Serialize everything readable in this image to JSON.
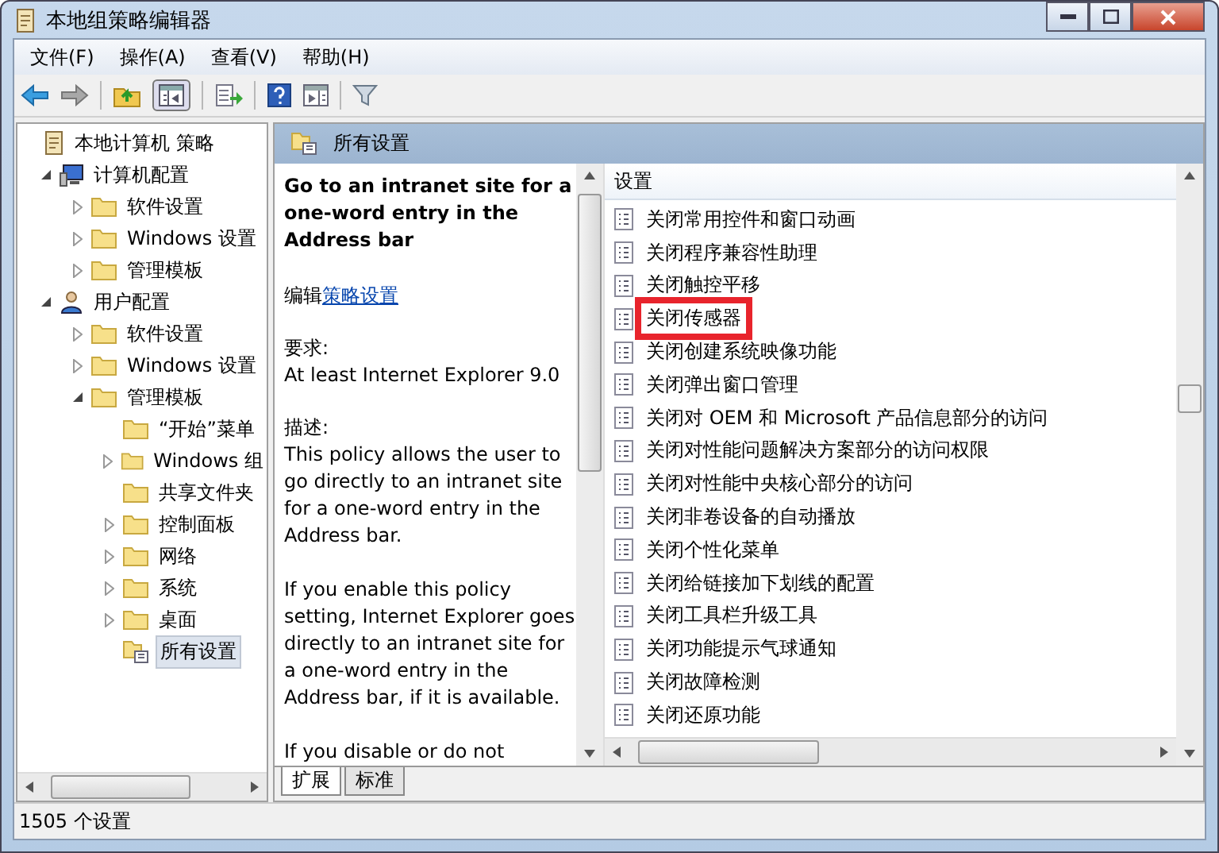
{
  "window": {
    "title": "本地组策略编辑器"
  },
  "menu": [
    "文件(F)",
    "操作(A)",
    "查看(V)",
    "帮助(H)"
  ],
  "tree": [
    {
      "label": "本地计算机 策略",
      "kind": "policy",
      "selected": false,
      "children": [
        {
          "label": "计算机配置",
          "kind": "computer",
          "expanded": true,
          "selected": false,
          "children": [
            {
              "label": "软件设置",
              "kind": "folder",
              "expanded": false,
              "selected": false
            },
            {
              "label": "Windows 设置",
              "kind": "folder",
              "expanded": false,
              "selected": false
            },
            {
              "label": "管理模板",
              "kind": "folder",
              "expanded": false,
              "selected": false
            }
          ]
        },
        {
          "label": "用户配置",
          "kind": "user",
          "expanded": true,
          "selected": false,
          "children": [
            {
              "label": "软件设置",
              "kind": "folder",
              "expanded": false,
              "selected": false
            },
            {
              "label": "Windows 设置",
              "kind": "folder",
              "expanded": false,
              "selected": false
            },
            {
              "label": "管理模板",
              "kind": "folder",
              "expanded": true,
              "selected": false,
              "children": [
                {
                  "label": "“开始”菜单",
                  "kind": "folder",
                  "selected": false
                },
                {
                  "label": "Windows 组",
                  "kind": "folder",
                  "expanded": false,
                  "selected": false
                },
                {
                  "label": "共享文件夹",
                  "kind": "folder",
                  "selected": false
                },
                {
                  "label": "控制面板",
                  "kind": "folder",
                  "expanded": false,
                  "selected": false
                },
                {
                  "label": "网络",
                  "kind": "folder",
                  "expanded": false,
                  "selected": false
                },
                {
                  "label": "系统",
                  "kind": "folder",
                  "expanded": false,
                  "selected": false
                },
                {
                  "label": "桌面",
                  "kind": "folder",
                  "expanded": false,
                  "selected": false
                },
                {
                  "label": "所有设置",
                  "kind": "settings",
                  "selected": true
                }
              ]
            }
          ]
        }
      ]
    }
  ],
  "header": {
    "title": "所有设置"
  },
  "description": {
    "title": "Go to an intranet site for a one-word entry in the Address bar",
    "edit_prefix": "编辑",
    "edit_link": "策略设置",
    "requirements_label": "要求:",
    "requirements": "At least Internet Explorer 9.0",
    "description_label": "描述:",
    "paragraphs": [
      "This policy allows the user to go directly to an intranet site for a one-word entry in the Address bar.",
      "If you enable this policy setting, Internet Explorer goes directly to an intranet site for a one-word entry in the Address bar, if it is available.",
      "If you disable or do not"
    ]
  },
  "list": {
    "column": "设置",
    "items": [
      {
        "label": "关闭常用控件和窗口动画",
        "highlighted": false
      },
      {
        "label": "关闭程序兼容性助理",
        "highlighted": false
      },
      {
        "label": "关闭触控平移",
        "highlighted": false
      },
      {
        "label": "关闭传感器",
        "highlighted": true
      },
      {
        "label": "关闭创建系统映像功能",
        "highlighted": false
      },
      {
        "label": "关闭弹出窗口管理",
        "highlighted": false
      },
      {
        "label": "关闭对 OEM 和 Microsoft 产品信息部分的访问",
        "highlighted": false
      },
      {
        "label": "关闭对性能问题解决方案部分的访问权限",
        "highlighted": false
      },
      {
        "label": "关闭对性能中央核心部分的访问",
        "highlighted": false
      },
      {
        "label": "关闭非卷设备的自动播放",
        "highlighted": false
      },
      {
        "label": "关闭个性化菜单",
        "highlighted": false
      },
      {
        "label": "关闭给链接加下划线的配置",
        "highlighted": false
      },
      {
        "label": "关闭工具栏升级工具",
        "highlighted": false
      },
      {
        "label": "关闭功能提示气球通知",
        "highlighted": false
      },
      {
        "label": "关闭故障检测",
        "highlighted": false
      },
      {
        "label": "关闭还原功能",
        "highlighted": false
      }
    ]
  },
  "tabs": [
    {
      "label": "扩展",
      "selected": true
    },
    {
      "label": "标准",
      "selected": false
    }
  ],
  "status_bar": {
    "text": "1505 个设置"
  }
}
